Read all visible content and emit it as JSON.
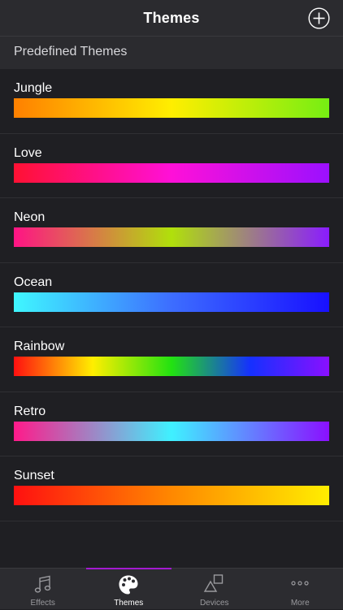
{
  "nav": {
    "title": "Themes",
    "add_icon": "plus-circle-icon"
  },
  "section": {
    "header": "Predefined Themes"
  },
  "themes": [
    {
      "name": "Jungle",
      "colors": [
        "#ff8000",
        "#ffee00",
        "#76ee13"
      ]
    },
    {
      "name": "Love",
      "colors": [
        "#ff1133",
        "#ff10d8",
        "#9b10ff"
      ]
    },
    {
      "name": "Neon",
      "colors": [
        "#ff1385",
        "#b0e00b",
        "#8a1cff"
      ]
    },
    {
      "name": "Ocean",
      "colors": [
        "#3ff7ff",
        "#3d6dff",
        "#1810ff"
      ]
    },
    {
      "name": "Rainbow",
      "colors": [
        "#ff1010",
        "#ffee00",
        "#22e211",
        "#1530ff",
        "#8a10ff"
      ]
    },
    {
      "name": "Retro",
      "colors": [
        "#ff1a8a",
        "#3ff1ff",
        "#8a10ff"
      ]
    },
    {
      "name": "Sunset",
      "colors": [
        "#ff1010",
        "#ff8800",
        "#ffee00"
      ]
    }
  ],
  "tabs": [
    {
      "label": "Effects",
      "icon": "music-note-icon",
      "active": false
    },
    {
      "label": "Themes",
      "icon": "palette-icon",
      "active": true
    },
    {
      "label": "Devices",
      "icon": "devices-shapes-icon",
      "active": false
    },
    {
      "label": "More",
      "icon": "more-dots-icon",
      "active": false
    }
  ],
  "colors": {
    "background": "#1f1f23",
    "bar": "#2b2b2f",
    "accent": "#a31ad1"
  }
}
